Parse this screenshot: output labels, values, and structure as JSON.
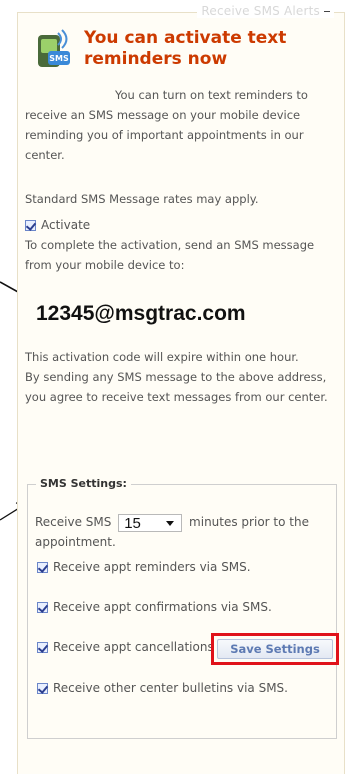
{
  "panel": {
    "legend": "Receive SMS Alerts",
    "headline": "You can activate text reminders now",
    "intro": "You can turn on text reminders to receive an SMS message on your mobile device reminding you of important appointments in our center.",
    "rates": "Standard SMS Message rates may apply.",
    "activate_label": "Activate",
    "activate_checked": true,
    "instructions": "To complete the activation, send an SMS message from your mobile device to:",
    "address": "12345@msgtrac.com",
    "expiry": "This activation code will expire within one hour.",
    "consent": "By sending any SMS message to the above address, you agree to receive text messages from our center."
  },
  "settings": {
    "legend": "SMS Settings:",
    "prior_before": "Receive SMS",
    "minutes_value": "15",
    "prior_after": "minutes prior to the appointment.",
    "options": [
      {
        "label": "Receive appt reminders via SMS.",
        "checked": true
      },
      {
        "label": "Receive appt confirmations via SMS.",
        "checked": true
      },
      {
        "label": "Receive appt cancellations via SMS.",
        "checked": true
      },
      {
        "label": "Receive other center bulletins via SMS.",
        "checked": true
      }
    ],
    "save_label": "Save Settings"
  },
  "colors": {
    "headline": "#cc3a00",
    "highlight": "#e0121a",
    "button_text": "#5d7ab3"
  }
}
